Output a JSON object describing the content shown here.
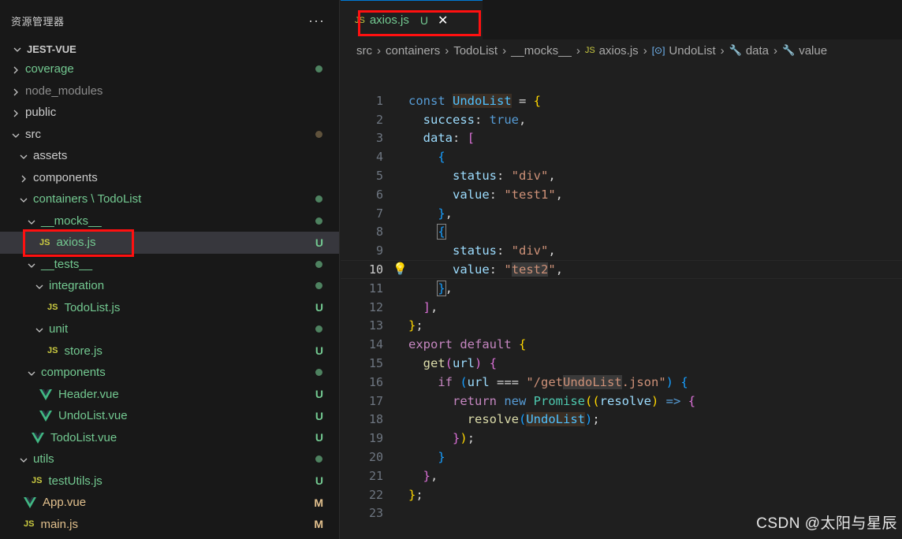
{
  "explorer": {
    "title": "资源管理器",
    "more_icon": "more-actions-icon",
    "project": "JEST-VUE",
    "items": [
      {
        "label": "coverage",
        "depth": 0,
        "type": "folder",
        "open": false,
        "color": "green",
        "status": "dot"
      },
      {
        "label": "node_modules",
        "depth": 0,
        "type": "folder",
        "open": false,
        "color": "gray",
        "status": ""
      },
      {
        "label": "public",
        "depth": 0,
        "type": "folder",
        "open": false,
        "color": "default",
        "status": ""
      },
      {
        "label": "src",
        "depth": 0,
        "type": "folder",
        "open": true,
        "color": "default",
        "status": "dot-brown"
      },
      {
        "label": "assets",
        "depth": 1,
        "type": "folder",
        "open": true,
        "color": "default",
        "status": ""
      },
      {
        "label": "components",
        "depth": 1,
        "type": "folder",
        "open": false,
        "color": "default",
        "status": ""
      },
      {
        "label": "containers \\ TodoList",
        "depth": 1,
        "type": "folder",
        "open": true,
        "color": "green",
        "status": "dot"
      },
      {
        "label": "__mocks__",
        "depth": 2,
        "type": "folder",
        "open": true,
        "color": "green",
        "status": "dot"
      },
      {
        "label": "axios.js",
        "depth": 3,
        "type": "js",
        "open": false,
        "color": "green",
        "status": "U",
        "selected": true
      },
      {
        "label": "__tests__",
        "depth": 2,
        "type": "folder",
        "open": true,
        "color": "green",
        "status": "dot"
      },
      {
        "label": "integration",
        "depth": 3,
        "type": "folder",
        "open": true,
        "color": "green",
        "status": "dot"
      },
      {
        "label": "TodoList.js",
        "depth": 4,
        "type": "js",
        "open": false,
        "color": "green",
        "status": "U"
      },
      {
        "label": "unit",
        "depth": 3,
        "type": "folder",
        "open": true,
        "color": "green",
        "status": "dot"
      },
      {
        "label": "store.js",
        "depth": 4,
        "type": "js",
        "open": false,
        "color": "green",
        "status": "U"
      },
      {
        "label": "components",
        "depth": 2,
        "type": "folder",
        "open": true,
        "color": "green",
        "status": "dot"
      },
      {
        "label": "Header.vue",
        "depth": 3,
        "type": "vue",
        "open": false,
        "color": "green",
        "status": "U"
      },
      {
        "label": "UndoList.vue",
        "depth": 3,
        "type": "vue",
        "open": false,
        "color": "green",
        "status": "U"
      },
      {
        "label": "TodoList.vue",
        "depth": 2,
        "type": "vue",
        "open": false,
        "color": "green",
        "status": "U"
      },
      {
        "label": "utils",
        "depth": 1,
        "type": "folder",
        "open": true,
        "color": "green",
        "status": "dot"
      },
      {
        "label": "testUtils.js",
        "depth": 2,
        "type": "js",
        "open": false,
        "color": "green",
        "status": "U"
      },
      {
        "label": "App.vue",
        "depth": 1,
        "type": "vue",
        "open": false,
        "color": "yellow",
        "status": "M"
      },
      {
        "label": "main.js",
        "depth": 1,
        "type": "js",
        "open": false,
        "color": "yellow",
        "status": "M"
      }
    ]
  },
  "tab": {
    "icon_text": "JS",
    "name": "axios.js",
    "status": "U",
    "close": "✕"
  },
  "breadcrumbs": [
    "src",
    "containers",
    "TodoList",
    "__mocks__",
    "axios.js",
    "UndoList",
    "data",
    "value"
  ],
  "breadcrumb_icons": {
    "axios.js": "JS",
    "UndoList": "[⊙]",
    "data": "🔧",
    "value": "🔧"
  },
  "editor": {
    "current_line": 10,
    "lines": [
      [
        [
          "kw",
          "const "
        ],
        [
          "var-hl",
          "UndoList"
        ],
        [
          "src",
          " = "
        ],
        [
          "b1",
          "{"
        ]
      ],
      [
        [
          "src",
          "  "
        ],
        [
          "prop",
          "success"
        ],
        [
          "src",
          ": "
        ],
        [
          "kw",
          "true"
        ],
        [
          "src",
          ","
        ]
      ],
      [
        [
          "src",
          "  "
        ],
        [
          "prop",
          "data"
        ],
        [
          "src",
          ": "
        ],
        [
          "b2",
          "["
        ]
      ],
      [
        [
          "src",
          "    "
        ],
        [
          "b3",
          "{"
        ]
      ],
      [
        [
          "src",
          "      "
        ],
        [
          "prop",
          "status"
        ],
        [
          "src",
          ": "
        ],
        [
          "str",
          "\"div\""
        ],
        [
          "src",
          ","
        ]
      ],
      [
        [
          "src",
          "      "
        ],
        [
          "prop",
          "value"
        ],
        [
          "src",
          ": "
        ],
        [
          "str",
          "\"test1\""
        ],
        [
          "src",
          ","
        ]
      ],
      [
        [
          "src",
          "    "
        ],
        [
          "b3",
          "}"
        ],
        [
          "src",
          ","
        ]
      ],
      [
        [
          "src",
          "    "
        ],
        [
          "b3box",
          "{"
        ]
      ],
      [
        [
          "src",
          "      "
        ],
        [
          "prop",
          "status"
        ],
        [
          "src",
          ": "
        ],
        [
          "str",
          "\"div\""
        ],
        [
          "src",
          ","
        ]
      ],
      [
        [
          "src",
          "      "
        ],
        [
          "prop",
          "value"
        ],
        [
          "src",
          ": "
        ],
        [
          "str",
          "\""
        ],
        [
          "str str-hl",
          "test2"
        ],
        [
          "str",
          "\""
        ],
        [
          "src",
          ","
        ]
      ],
      [
        [
          "src",
          "    "
        ],
        [
          "b3box",
          "}"
        ],
        [
          "src",
          ","
        ]
      ],
      [
        [
          "src",
          "  "
        ],
        [
          "b2",
          "]"
        ],
        [
          "src",
          ","
        ]
      ],
      [
        [
          "b1",
          "}"
        ],
        [
          "src",
          ";"
        ]
      ],
      [
        [
          "kw2",
          "export "
        ],
        [
          "kw2",
          "default "
        ],
        [
          "b1",
          "{"
        ]
      ],
      [
        [
          "src",
          "  "
        ],
        [
          "fn",
          "get"
        ],
        [
          "b2",
          "("
        ],
        [
          "prop",
          "url"
        ],
        [
          "b2",
          ")"
        ],
        [
          "src",
          " "
        ],
        [
          "b2",
          "{"
        ]
      ],
      [
        [
          "src",
          "    "
        ],
        [
          "kw2",
          "if "
        ],
        [
          "b3",
          "("
        ],
        [
          "prop",
          "url"
        ],
        [
          "src",
          " === "
        ],
        [
          "str",
          "\"/get"
        ],
        [
          "str str-hl",
          "UndoList"
        ],
        [
          "str",
          ".json\""
        ],
        [
          "b3",
          ")"
        ],
        [
          "src",
          " "
        ],
        [
          "b3",
          "{"
        ]
      ],
      [
        [
          "src",
          "      "
        ],
        [
          "kw2",
          "return "
        ],
        [
          "kw",
          "new "
        ],
        [
          "cls",
          "Promise"
        ],
        [
          "b1",
          "(("
        ],
        [
          "prop",
          "resolve"
        ],
        [
          "b1",
          ")"
        ],
        [
          "src",
          " "
        ],
        [
          "kw",
          "=>"
        ],
        [
          "src",
          " "
        ],
        [
          "b2",
          "{"
        ]
      ],
      [
        [
          "src",
          "        "
        ],
        [
          "fn",
          "resolve"
        ],
        [
          "b3",
          "("
        ],
        [
          "var-hl",
          "UndoList"
        ],
        [
          "b3",
          ")"
        ],
        [
          "src",
          ";"
        ]
      ],
      [
        [
          "src",
          "      "
        ],
        [
          "b2",
          "}"
        ],
        [
          "b1",
          ")"
        ],
        [
          "src",
          ";"
        ]
      ],
      [
        [
          "src",
          "    "
        ],
        [
          "b3",
          "}"
        ]
      ],
      [
        [
          "src",
          "  "
        ],
        [
          "b2",
          "}"
        ],
        [
          "src",
          ","
        ]
      ],
      [
        [
          "b1",
          "}"
        ],
        [
          "src",
          ";"
        ]
      ],
      []
    ]
  },
  "watermark": "CSDN @太阳与星辰",
  "colors": {
    "annotation_red": "#ff1010",
    "untracked_green": "#73c991",
    "modified_yellow": "#e2c08d"
  }
}
